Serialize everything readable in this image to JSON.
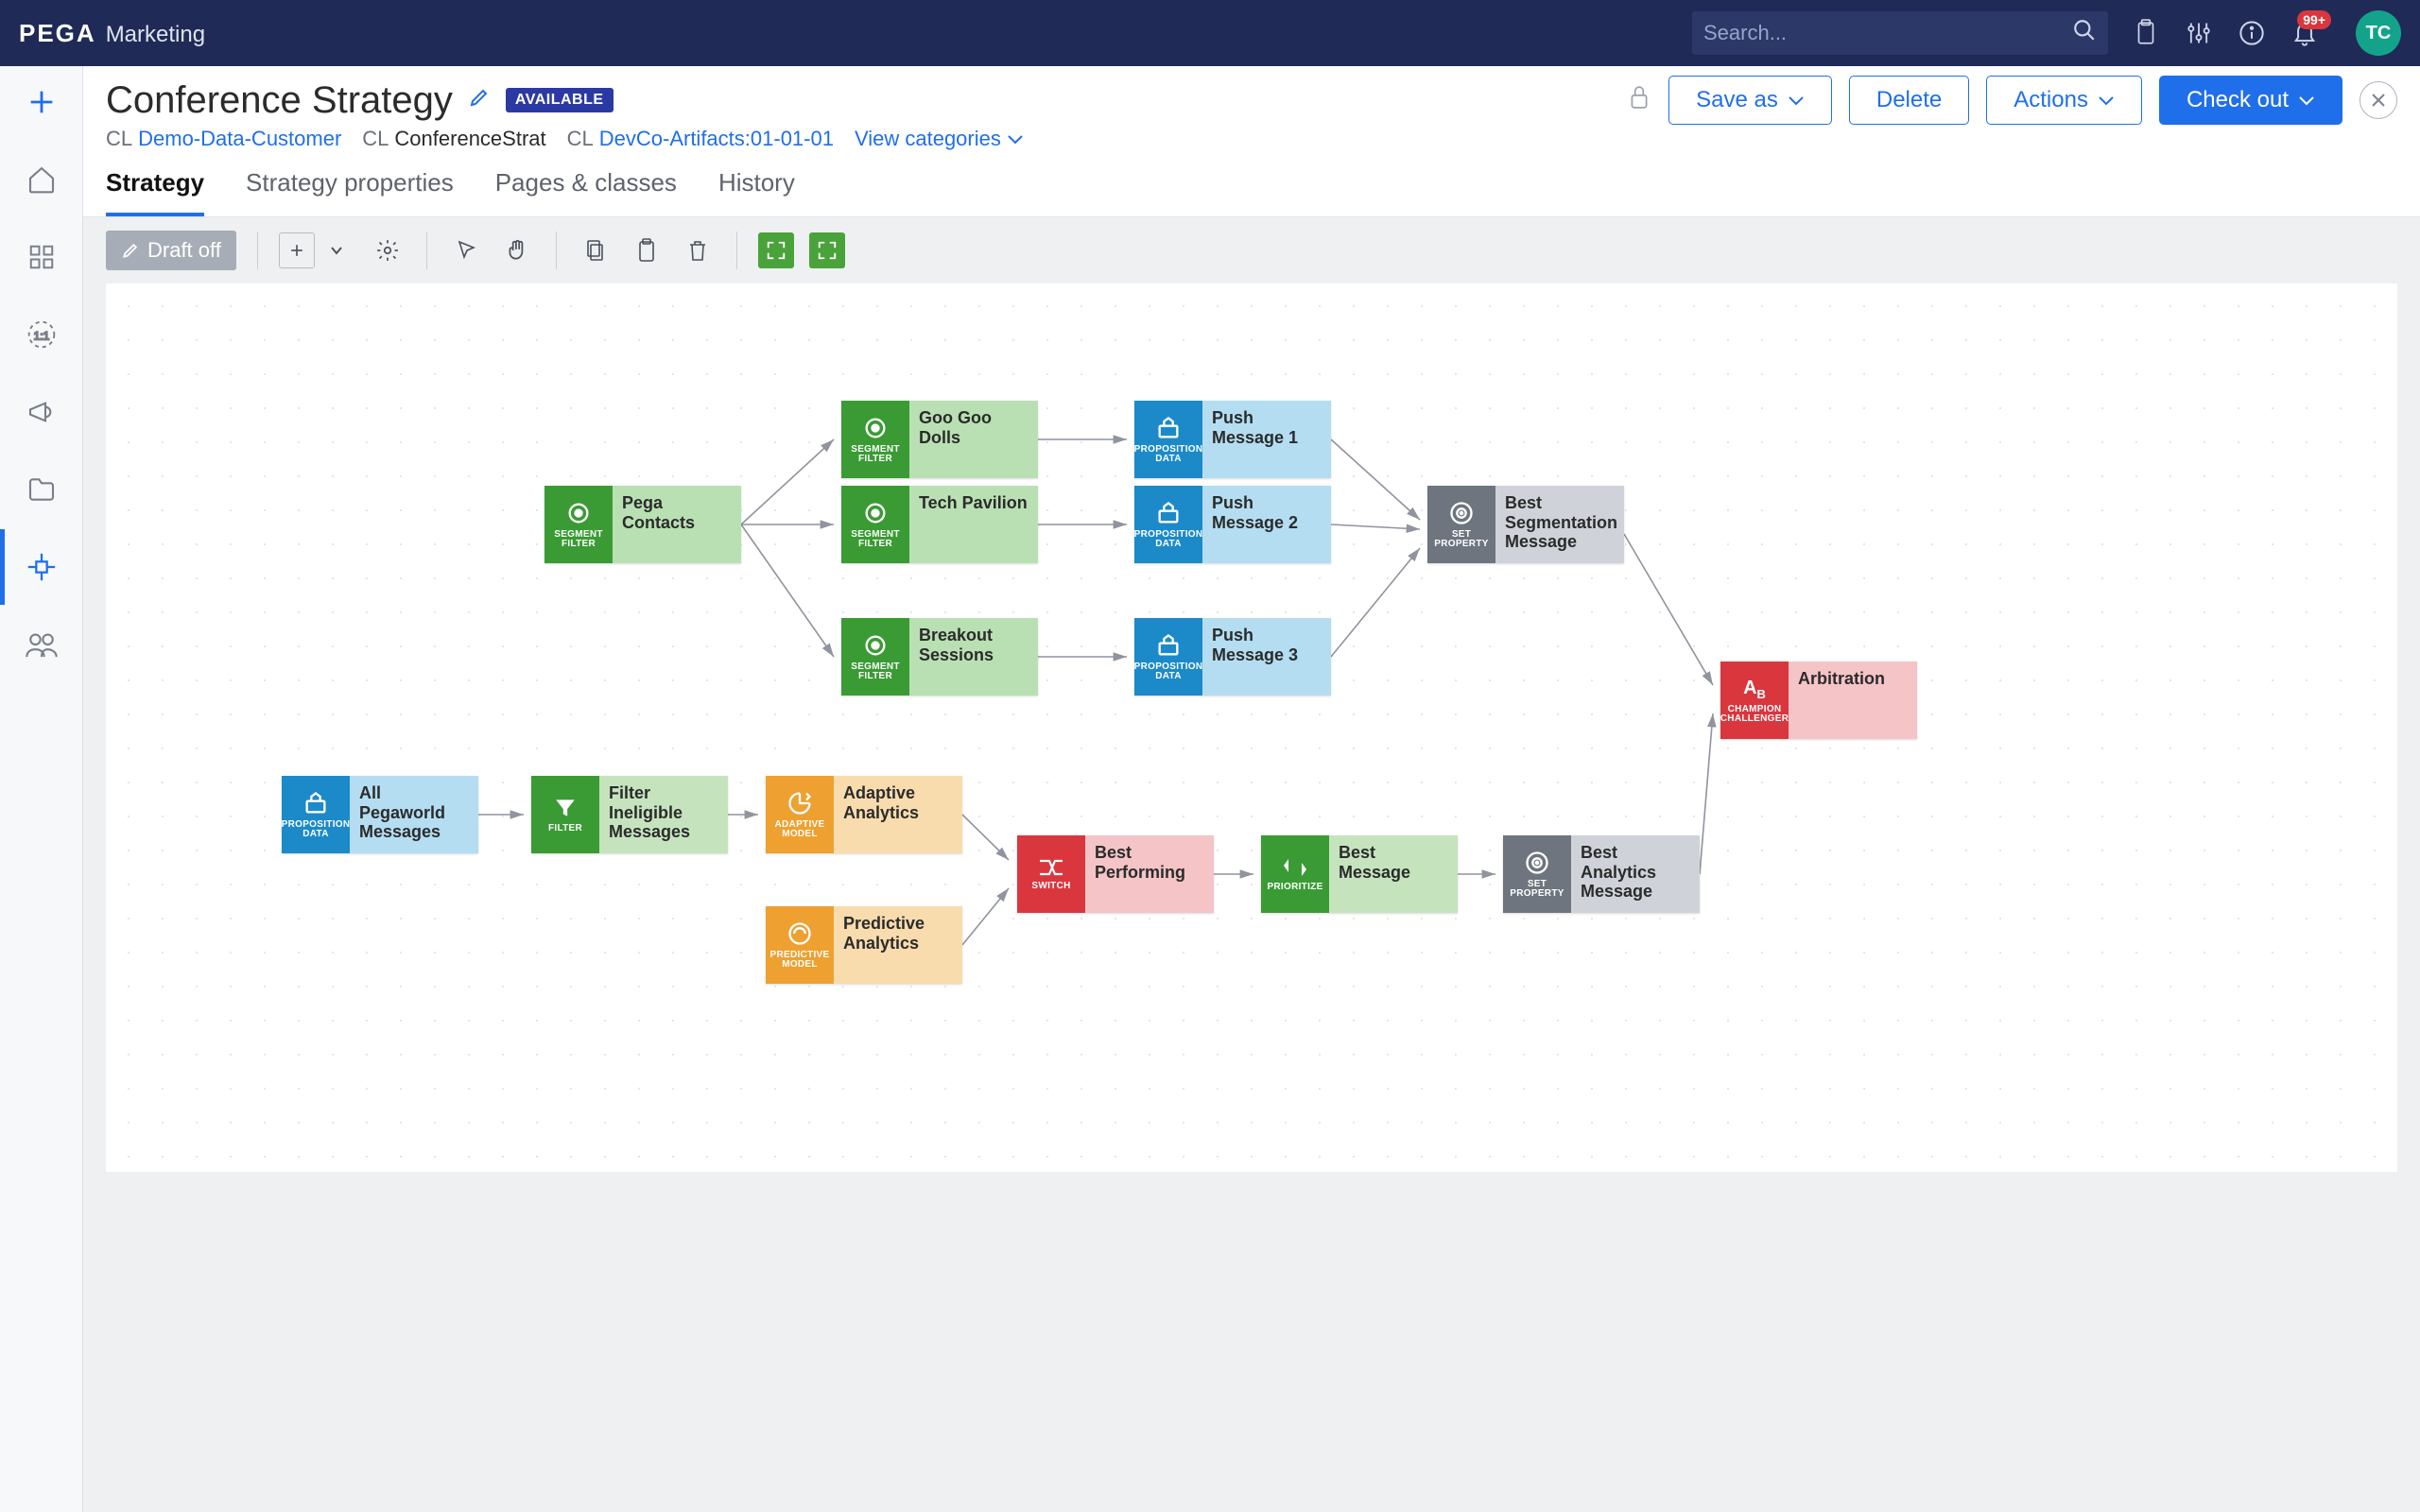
{
  "brand": {
    "logo": "PEGA",
    "product": "Marketing"
  },
  "search": {
    "placeholder": "Search..."
  },
  "notifications": {
    "badge": "99+"
  },
  "user": {
    "initials": "TC"
  },
  "header": {
    "title": "Conference Strategy",
    "status": "AVAILABLE",
    "crumbs": {
      "cl_label": "CL",
      "class_link": "Demo-Data-Customer",
      "name_label": "CL",
      "name_value": "ConferenceStrat",
      "artifact_label": "CL",
      "artifact_link": "DevCo-Artifacts:01-01-01",
      "view_categories": "View categories"
    },
    "buttons": {
      "save_as": "Save as",
      "delete": "Delete",
      "actions": "Actions",
      "check_out": "Check out"
    }
  },
  "tabs": [
    {
      "label": "Strategy",
      "active": true
    },
    {
      "label": "Strategy properties",
      "active": false
    },
    {
      "label": "Pages & classes",
      "active": false
    },
    {
      "label": "History",
      "active": false
    }
  ],
  "toolbar": {
    "draft": "Draft off"
  },
  "node_sublabels": {
    "segment": "SEGMENT FILTER",
    "propdata": "PROPOSITION DATA",
    "setprop": "SET PROPERTY",
    "champ": "CHAMPION CHALLENGER",
    "filter": "FILTER",
    "adaptive": "ADAPTIVE MODEL",
    "predict": "PREDICTIVE MODEL",
    "switch": "SWITCH",
    "prior": "PRIORITIZE"
  },
  "nodes": {
    "pega_contacts": "Pega Contacts",
    "googoo": "Goo Goo Dolls",
    "tech": "Tech Pavilion",
    "breakout": "Breakout Sessions",
    "push1": "Push Message 1",
    "push2": "Push Message 2",
    "push3": "Push Message 3",
    "best_seg": "Best Segmentation Message",
    "arbitration": "Arbitration",
    "allpw": "All Pegaworld Messages",
    "filter_inelig": "Filter Ineligible Messages",
    "adaptive": "Adaptive Analytics",
    "predictive": "Predictive Analytics",
    "best_perf": "Best Performing",
    "best_msg": "Best Message",
    "best_analytics": "Best Analytics Message"
  }
}
